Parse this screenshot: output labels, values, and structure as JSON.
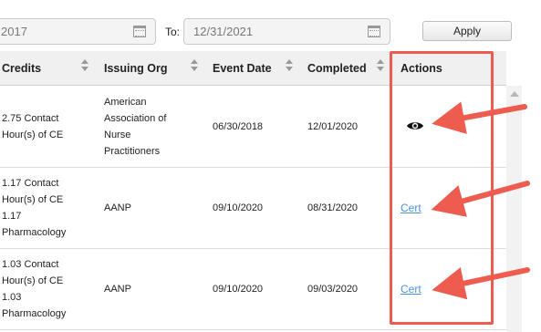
{
  "filter": {
    "from_value": "2017",
    "to_label": "To:",
    "to_value": "12/31/2021",
    "apply_label": "Apply"
  },
  "table": {
    "headers": {
      "credits": "Credits",
      "issuing_org": "Issuing Org",
      "event_date": "Event Date",
      "completed": "Completed",
      "actions": "Actions"
    },
    "rows": [
      {
        "credits": [
          "2.75 Contact",
          "Hour(s) of CE"
        ],
        "issuing_org": [
          "American",
          "Association of",
          "Nurse",
          "Practitioners"
        ],
        "event_date": "06/30/2018",
        "completed": "12/01/2020",
        "action": "view"
      },
      {
        "credits": [
          "1.17 Contact",
          "Hour(s) of CE",
          "1.17",
          "Pharmacology"
        ],
        "issuing_org": [
          "AANP"
        ],
        "event_date": "09/10/2020",
        "completed": "08/31/2020",
        "action": "Cert"
      },
      {
        "credits": [
          "1.03 Contact",
          "Hour(s) of CE",
          "1.03",
          "Pharmacology"
        ],
        "issuing_org": [
          "AANP"
        ],
        "event_date": "09/10/2020",
        "completed": "09/03/2020",
        "action": "Cert"
      }
    ]
  },
  "icons": {
    "calendar": "calendar-icon",
    "view": "eye-icon",
    "sort": "sort-icon"
  },
  "colors": {
    "annotation": "#ee5b4f",
    "link": "#4a90d9",
    "header_bg": "#f0f0f0"
  }
}
